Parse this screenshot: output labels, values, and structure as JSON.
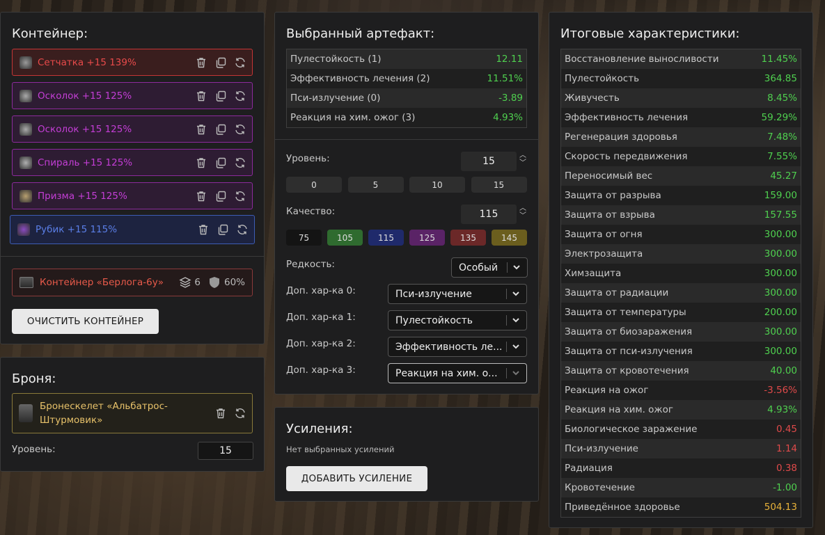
{
  "container": {
    "title": "Контейнер:",
    "items": [
      {
        "label": "Сетчатка +15 139%",
        "color": "#e84a4a",
        "border": "#c43535",
        "bg": "#3a1e1e",
        "icon": "retina-artifact-icon"
      },
      {
        "label": "Осколок +15 125%",
        "color": "#c43ed6",
        "border": "#8d2a9d",
        "bg": "#2e1c33",
        "icon": "shard-artifact-icon"
      },
      {
        "label": "Осколок +15 125%",
        "color": "#c43ed6",
        "border": "#8d2a9d",
        "bg": "#2e1c33",
        "icon": "shard-artifact-icon"
      },
      {
        "label": "Спираль +15 125%",
        "color": "#c43ed6",
        "border": "#8d2a9d",
        "bg": "#2e1c33",
        "icon": "spiral-artifact-icon"
      },
      {
        "label": "Призма +15 125%",
        "color": "#c43ed6",
        "border": "#8d2a9d",
        "bg": "#2e1c33",
        "icon": "prism-artifact-icon"
      },
      {
        "label": "Рубик +15 115%",
        "color": "#5b7fe8",
        "border": "#3d5db5",
        "bg": "#1d2340",
        "icon": "rubik-artifact-icon"
      }
    ],
    "storage": {
      "label": "Контейнер «Берлога-6у»",
      "slots": "6",
      "protection": "60%"
    },
    "clear_button": "ОЧИСТИТЬ КОНТЕЙНЕР"
  },
  "armor": {
    "title": "Броня:",
    "name": "Бронескелет «Альбатрос-Штурмовик»",
    "level_label": "Уровень:",
    "level": "15"
  },
  "artifact": {
    "title": "Выбранный артефакт:",
    "stats": [
      {
        "name": "Пулестойкость (1)",
        "value": "12.11",
        "tone": "pos"
      },
      {
        "name": "Эффективность лечения (2)",
        "value": "11.51%",
        "tone": "pos"
      },
      {
        "name": "Пси-излучение (0)",
        "value": "-3.89",
        "tone": "pos"
      },
      {
        "name": "Реакция на хим. ожог (3)",
        "value": "4.93%",
        "tone": "pos"
      }
    ],
    "level_label": "Уровень:",
    "level": "15",
    "level_presets": [
      "0",
      "5",
      "10",
      "15"
    ],
    "quality_label": "Качество:",
    "quality": "115",
    "quality_presets": [
      {
        "v": "75",
        "bg": "#141414"
      },
      {
        "v": "105",
        "bg": "#2f6b2f"
      },
      {
        "v": "115",
        "bg": "#1f2a6b"
      },
      {
        "v": "125",
        "bg": "#5a2366"
      },
      {
        "v": "135",
        "bg": "#6b2828"
      },
      {
        "v": "145",
        "bg": "#6b5e1e"
      }
    ],
    "rarity_label": "Редкость:",
    "rarity": "Особый",
    "extra": [
      {
        "label": "Доп. хар-ка 0:",
        "value": "Пси-излучение"
      },
      {
        "label": "Доп. хар-ка 1:",
        "value": "Пулестойкость"
      },
      {
        "label": "Доп. хар-ка 2:",
        "value": "Эффективность ле..."
      },
      {
        "label": "Доп. хар-ка 3:",
        "value": "Реакция на хим. о..."
      }
    ]
  },
  "boosts": {
    "title": "Усиления:",
    "empty": "Нет выбранных усилений",
    "add_button": "ДОБАВИТЬ УСИЛЕНИЕ"
  },
  "totals": {
    "title": "Итоговые характеристики:",
    "rows": [
      {
        "name": "Восстановление выносливости",
        "value": "11.45%",
        "tone": "pos"
      },
      {
        "name": "Пулестойкость",
        "value": "364.85",
        "tone": "pos"
      },
      {
        "name": "Живучесть",
        "value": "8.45%",
        "tone": "pos"
      },
      {
        "name": "Эффективность лечения",
        "value": "59.29%",
        "tone": "pos"
      },
      {
        "name": "Регенерация здоровья",
        "value": "7.48%",
        "tone": "pos"
      },
      {
        "name": "Скорость передвижения",
        "value": "7.55%",
        "tone": "pos"
      },
      {
        "name": "Переносимый вес",
        "value": "45.27",
        "tone": "pos"
      },
      {
        "name": "Защита от разрыва",
        "value": "159.00",
        "tone": "pos"
      },
      {
        "name": "Защита от взрыва",
        "value": "157.55",
        "tone": "pos"
      },
      {
        "name": "Защита от огня",
        "value": "300.00",
        "tone": "pos"
      },
      {
        "name": "Электрозащита",
        "value": "300.00",
        "tone": "pos"
      },
      {
        "name": "Химзащита",
        "value": "300.00",
        "tone": "pos"
      },
      {
        "name": "Защита от радиации",
        "value": "300.00",
        "tone": "pos"
      },
      {
        "name": "Защита от температуры",
        "value": "200.00",
        "tone": "pos"
      },
      {
        "name": "Защита от биозаражения",
        "value": "300.00",
        "tone": "pos"
      },
      {
        "name": "Защита от пси-излучения",
        "value": "300.00",
        "tone": "pos"
      },
      {
        "name": "Защита от кровотечения",
        "value": "40.00",
        "tone": "pos"
      },
      {
        "name": "Реакция на ожог",
        "value": "-3.56%",
        "tone": "neg"
      },
      {
        "name": "Реакция на хим. ожог",
        "value": "4.93%",
        "tone": "pos"
      },
      {
        "name": "Биологическое заражение",
        "value": "0.45",
        "tone": "neg"
      },
      {
        "name": "Пси-излучение",
        "value": "1.14",
        "tone": "neg"
      },
      {
        "name": "Радиация",
        "value": "0.38",
        "tone": "neg"
      },
      {
        "name": "Кровотечение",
        "value": "-1.00",
        "tone": "pos"
      },
      {
        "name": "Приведённое здоровье",
        "value": "504.13",
        "tone": "gold"
      }
    ]
  }
}
